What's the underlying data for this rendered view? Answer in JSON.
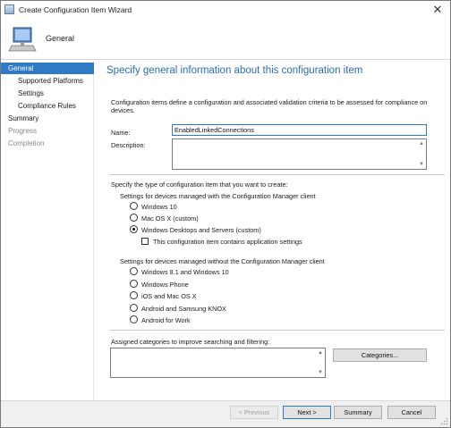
{
  "window": {
    "title": "Create Configuration Item Wizard",
    "close_glyph": "✕",
    "header_title": "General"
  },
  "nav": {
    "items": [
      {
        "label": "General"
      },
      {
        "label": "Supported Platforms"
      },
      {
        "label": "Settings"
      },
      {
        "label": "Compliance Rules"
      },
      {
        "label": "Summary"
      },
      {
        "label": "Progress"
      },
      {
        "label": "Completion"
      }
    ]
  },
  "main": {
    "page_title": "Specify general information about this configuration item",
    "intro": "Configuration items define a configuration and associated validation criteria to be assessed for compliance on devices.",
    "name_label": "Name:",
    "name_value": "EnabledLinkedConnections",
    "description_label": "Description:",
    "description_value": "",
    "type_prompt": "Specify the type of configuration item that you want to create:",
    "managed_group_label": "Settings for devices managed with the Configuration Manager client",
    "managed_options": [
      {
        "label": "Windows 10",
        "checked": false
      },
      {
        "label": "Mac OS X (custom)",
        "checked": false
      },
      {
        "label": "Windows Desktops and Servers (custom)",
        "checked": true
      }
    ],
    "app_settings_label": "This configuration item contains application settings",
    "app_settings_checked": false,
    "unmanaged_group_label": "Settings for devices managed without the Configuration Manager client",
    "unmanaged_options": [
      {
        "label": "Windows 8.1 and Windows 10",
        "checked": false
      },
      {
        "label": "Windows Phone",
        "checked": false
      },
      {
        "label": "iOS and Mac OS X",
        "checked": false
      },
      {
        "label": "Android and Samsung KNOX",
        "checked": false
      },
      {
        "label": "Android for Work",
        "checked": false
      }
    ],
    "categories_label": "Assigned categories to improve searching and filtering:",
    "categories_button": "Categories..."
  },
  "footer": {
    "previous": "< Previous",
    "next": "Next >",
    "summary": "Summary",
    "cancel": "Cancel"
  },
  "colors": {
    "accent": "#3079c5",
    "title_blue": "#2a6cb5"
  },
  "icons": {
    "app": "wizard-window-icon",
    "header": "computer-monitor-icon",
    "close": "close-icon"
  }
}
